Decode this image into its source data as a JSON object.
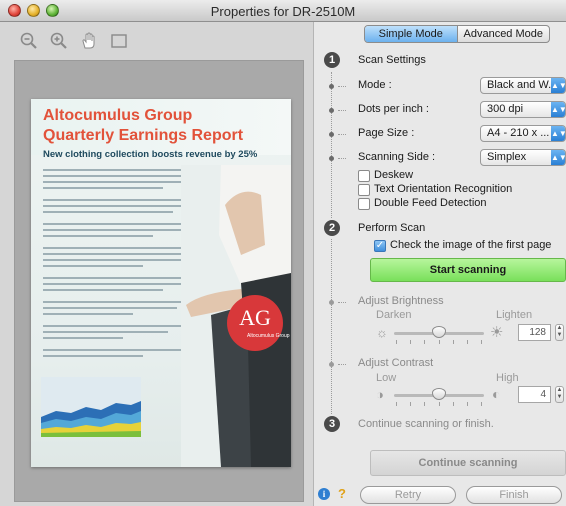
{
  "window": {
    "title": "Properties for DR-2510M"
  },
  "preview": {
    "doc_title_line1": "Altocumulus Group",
    "doc_title_line2": "Quarterly Earnings Report",
    "doc_subtitle": "New clothing collection boosts revenue by 25%",
    "badge_text": "AG",
    "badge_subtext": "Altocumulus Group"
  },
  "mode_tabs": {
    "simple": "Simple Mode",
    "advanced": "Advanced Mode",
    "active": "simple"
  },
  "step1": {
    "number": "1",
    "title": "Scan Settings",
    "rows": [
      {
        "label": "Mode :",
        "value": "Black and W..."
      },
      {
        "label": "Dots per inch :",
        "value": "300 dpi"
      },
      {
        "label": "Page Size :",
        "value": "A4 - 210 x ..."
      },
      {
        "label": "Scanning Side :",
        "value": "Simplex"
      }
    ],
    "checks": [
      {
        "label": "Deskew",
        "checked": false
      },
      {
        "label": "Text Orientation Recognition",
        "checked": false
      },
      {
        "label": "Double Feed Detection",
        "checked": false
      }
    ]
  },
  "step2": {
    "number": "2",
    "title": "Perform Scan",
    "check_first_page": "Check the image of the first page",
    "check_first_page_checked": true,
    "start_button": "Start scanning"
  },
  "brightness": {
    "title": "Adjust Brightness",
    "low_label": "Darken",
    "high_label": "Lighten",
    "value": "128",
    "level": 0.5
  },
  "contrast": {
    "title": "Adjust Contrast",
    "low_label": "Low",
    "high_label": "High",
    "value": "4",
    "level": 0.5
  },
  "step3": {
    "number": "3",
    "title": "Continue scanning or finish.",
    "continue_button": "Continue scanning"
  },
  "footer": {
    "retry": "Retry",
    "finish": "Finish"
  },
  "colors": {
    "accent_blue": "#6cb1ee",
    "start_green": "#79e05a",
    "doc_title_red": "#e2523a",
    "badge_red": "#d8383a"
  }
}
